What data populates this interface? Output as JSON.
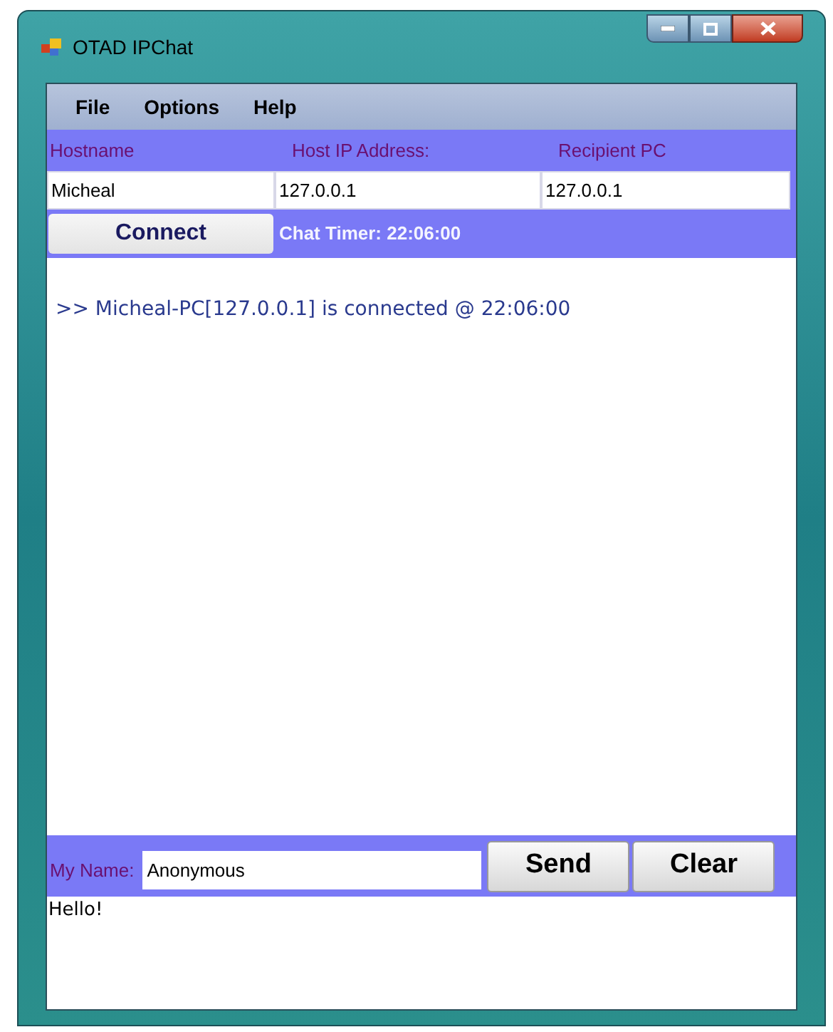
{
  "window": {
    "title": "OTAD IPChat"
  },
  "menu": [
    "File",
    "Options",
    "Help"
  ],
  "hosts": {
    "columns": [
      "Hostname",
      "Host IP Address:",
      "Recipient PC"
    ],
    "values": [
      "Micheal",
      "127.0.0.1",
      "127.0.0.1"
    ]
  },
  "connect_button": "Connect",
  "chat_timer": "Chat Timer: 22:06:00",
  "chat_log": [
    ">> Micheal-PC[127.0.0.1] is connected @ 22:06:00"
  ],
  "name_label": "My Name:",
  "name_value": "Anonymous",
  "buttons": [
    "Send",
    "Clear"
  ],
  "message": "Hello!"
}
